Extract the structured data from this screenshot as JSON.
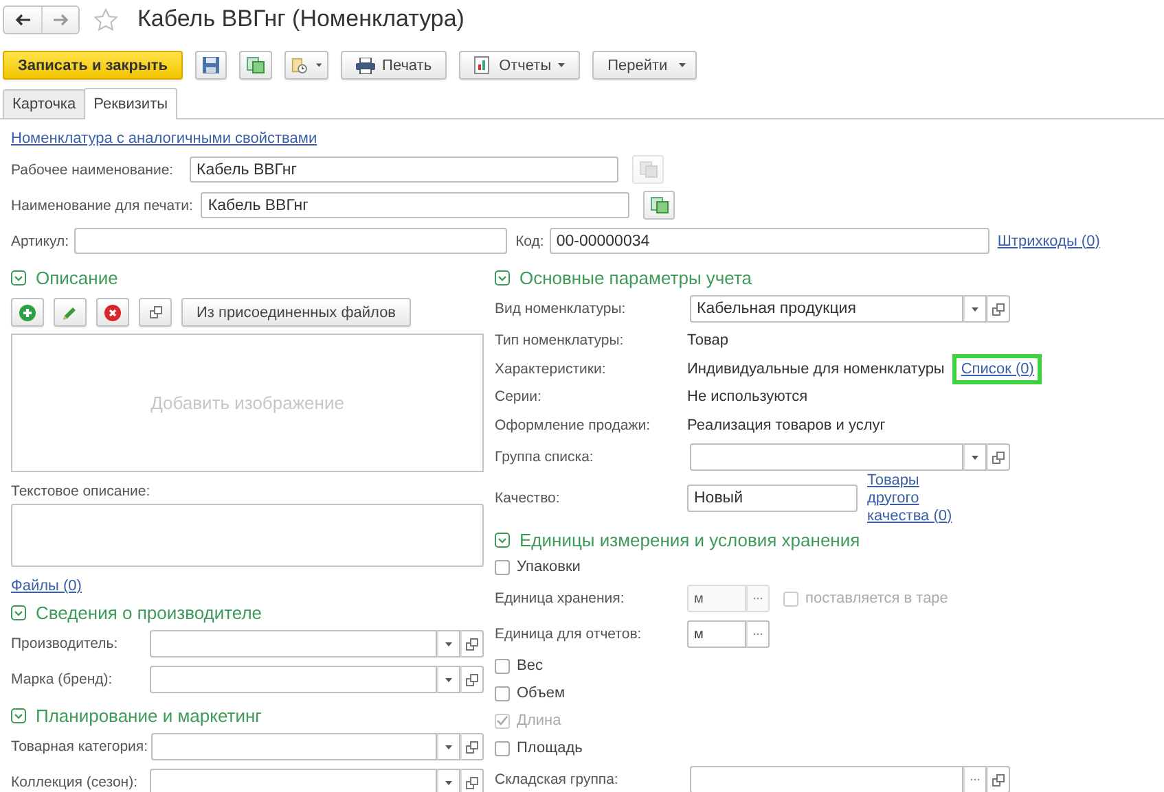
{
  "title": "Кабель ВВГнг (Номенклатура)",
  "favorite": false,
  "toolbar": [
    {
      "kind": "primary",
      "label": "Записать и закрыть"
    },
    {
      "kind": "icon",
      "menu": false
    },
    {
      "kind": "icon",
      "menu": false
    },
    {
      "kind": "icon",
      "menu": true
    },
    {
      "kind": "icon-text",
      "label": "Печать",
      "menu": false
    },
    {
      "kind": "icon-text",
      "label": "Отчеты",
      "menu": true
    },
    {
      "kind": "text",
      "label": "Перейти",
      "menu": true
    }
  ],
  "tabs": [
    {
      "label": "Карточка",
      "selected": false
    },
    {
      "label": "Реквизиты",
      "selected": true
    }
  ],
  "top_link": "Номенклатура с аналогичными свойствами",
  "name_rows": [
    {
      "label": "Рабочее наименование:",
      "value": "Кабель ВВГнг",
      "button_enabled": false
    },
    {
      "label": "Наименование для печати:",
      "value": "Кабель ВВГнг",
      "button_enabled": true
    }
  ],
  "article": {
    "label": "Артикул:"
  },
  "code": {
    "label": "Код:",
    "value": "00-00000034"
  },
  "barcodes_link": "Штрихкоды (0)",
  "left": [
    {
      "kind": "section",
      "title": "Описание",
      "expanded": true
    },
    {
      "kind": "tools",
      "buttons": [
        {
          "kind": "icon"
        },
        {
          "kind": "icon"
        },
        {
          "kind": "icon"
        },
        {
          "kind": "icon"
        },
        {
          "kind": "text",
          "label": "Из присоединенных файлов"
        }
      ]
    },
    {
      "kind": "image",
      "placeholder": "Добавить изображение"
    },
    {
      "kind": "label",
      "text": "Текстовое описание:"
    },
    {
      "kind": "textarea"
    },
    {
      "kind": "link",
      "text": "Файлы (0)"
    },
    {
      "kind": "section",
      "title": "Сведения о производителе",
      "expanded": true
    },
    {
      "kind": "select",
      "label": "Производитель:"
    },
    {
      "kind": "select",
      "label": "Марка (бренд):"
    },
    {
      "kind": "section",
      "title": "Планирование и маркетинг",
      "expanded": true
    },
    {
      "kind": "select",
      "label": "Товарная категория:"
    },
    {
      "kind": "select",
      "label": "Коллекция (сезон):"
    }
  ],
  "right": [
    {
      "kind": "section",
      "title": "Основные параметры учета",
      "expanded": true
    },
    {
      "kind": "select",
      "label": "Вид номенклатуры:",
      "value": "Кабельная продукция"
    },
    {
      "kind": "info",
      "label": "Тип номенклатуры:",
      "value": "Товар"
    },
    {
      "kind": "info",
      "label": "Характеристики:",
      "value": "Индивидуальные для номенклатуры",
      "link": "Список (0)",
      "highlighted": true
    },
    {
      "kind": "info",
      "label": "Серии:",
      "value": "Не используются"
    },
    {
      "kind": "info",
      "label": "Оформление продажи:",
      "value": "Реализация товаров и услуг"
    },
    {
      "kind": "select",
      "label": "Группа списка:"
    },
    {
      "kind": "input",
      "label": "Качество:",
      "value": "Новый",
      "link": "Товары другого качества (0)"
    },
    {
      "kind": "section",
      "title": "Единицы измерения и условия хранения",
      "expanded": true
    },
    {
      "kind": "checkbox",
      "label": "Упаковки",
      "checked": false,
      "disabled": false
    },
    {
      "kind": "unit",
      "label": "Единица хранения:",
      "value": "м",
      "disabled": true,
      "option": {
        "label": "поставляется в таре",
        "checked": false
      }
    },
    {
      "kind": "unit",
      "label": "Единица для отчетов:",
      "value": "м",
      "disabled": false
    },
    {
      "kind": "checkbox",
      "label": "Вес",
      "checked": false,
      "disabled": false
    },
    {
      "kind": "checkbox",
      "label": "Объем",
      "checked": false,
      "disabled": false
    },
    {
      "kind": "checkbox",
      "label": "Длина",
      "checked": true,
      "disabled": true
    },
    {
      "kind": "checkbox",
      "label": "Площадь",
      "checked": false,
      "disabled": false
    },
    {
      "kind": "choice",
      "label": "Складская группа:"
    }
  ]
}
